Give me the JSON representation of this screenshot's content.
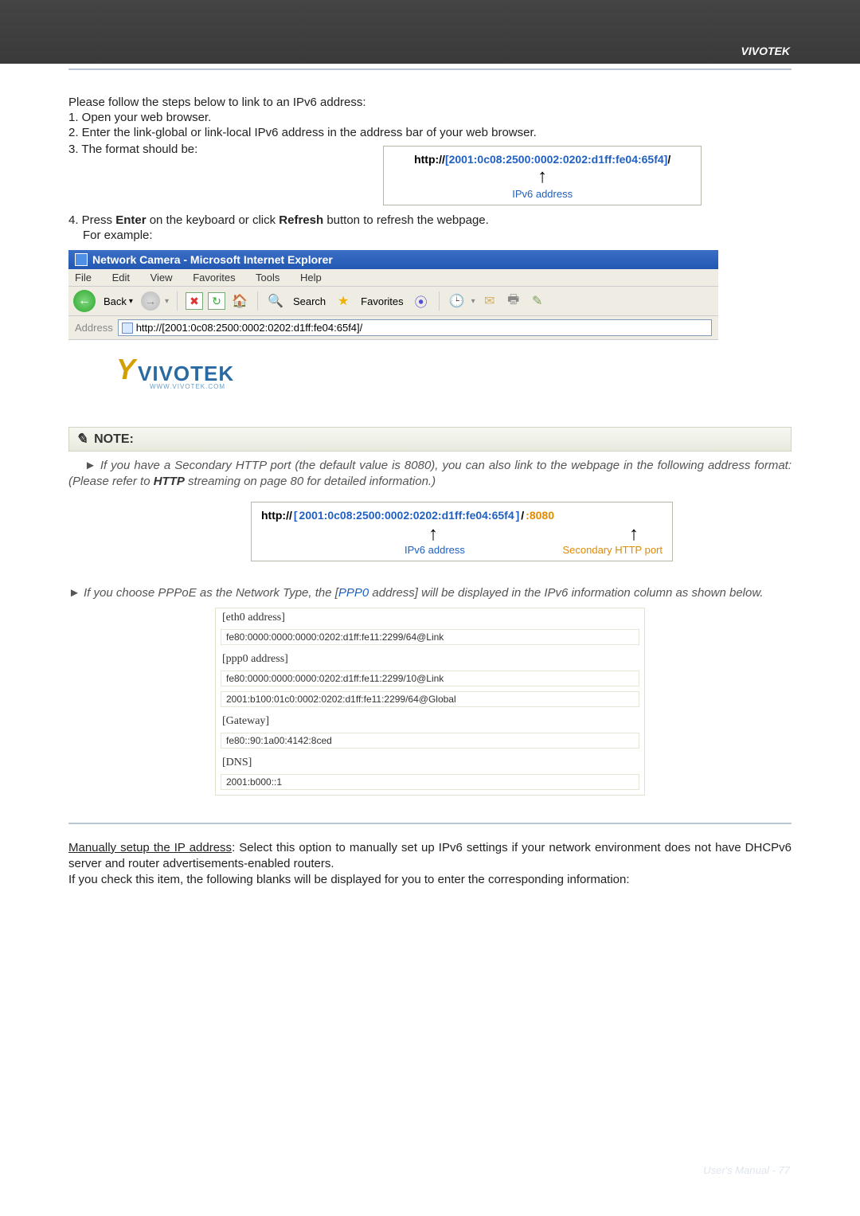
{
  "brand": "VIVOTEK",
  "intro": {
    "line": "Please follow the steps below to link to an IPv6 address:",
    "step1": "1. Open your web browser.",
    "step2": "2. Enter the link-global or link-local IPv6 address in the address bar of your web browser.",
    "step3": "3. The format should be:",
    "step4": "4. Press Enter on the keyboard or click Refresh button to refresh the webpage.",
    "step4b": "For example:",
    "enter": "Enter",
    "refresh": "Refresh"
  },
  "urlbox1": {
    "prefix": "http://",
    "open": "[",
    "addr": "2001:0c08:2500:0002:0202:d1ff:fe04:65f4",
    "close": "]",
    "suffix": "/",
    "label": "IPv6 address"
  },
  "ie": {
    "title": "Network Camera - Microsoft Internet Explorer",
    "menu": {
      "file": "File",
      "edit": "Edit",
      "view": "View",
      "fav": "Favorites",
      "tools": "Tools",
      "help": "Help"
    },
    "tb": {
      "back": "Back",
      "search": "Search",
      "fav": "Favorites"
    },
    "addrlabel": "Address",
    "addrvalue": "http://[2001:0c08:2500:0002:0202:d1ff:fe04:65f4]/",
    "logo": "VIVOTEK",
    "logosub": "WWW.VIVOTEK.COM"
  },
  "note": {
    "title": "NOTE:",
    "p1a": "► If you have a Secondary HTTP port (the default value is 8080), you can also link to the webpage in the following address format: (Please refer to ",
    "p1b": "HTTP",
    "p1c": " streaming on page 80 for detailed information.)",
    "p2a": "► If you choose PPPoE as the Network Type, the [",
    "p2b": "PPP0",
    "p2c": " address] will be displayed in the IPv6 information column as shown below."
  },
  "urlbox2": {
    "prefix": "http://",
    "open": "[",
    "addr": "2001:0c08:2500:0002:0202:d1ff:fe04:65f4",
    "close": "]",
    "suffix": "/",
    "port": ":8080",
    "label1": "IPv6 address",
    "label2": "Secondary HTTP port"
  },
  "ipv6table": {
    "eth_hdr": "[eth0 address]",
    "eth_val": "fe80:0000:0000:0000:0202:d1ff:fe11:2299/64@Link",
    "ppp_hdr": "[ppp0 address]",
    "ppp_val1": "fe80:0000:0000:0000:0202:d1ff:fe11:2299/10@Link",
    "ppp_val2": "2001:b100:01c0:0002:0202:d1ff:fe11:2299/64@Global",
    "gw_hdr": "[Gateway]",
    "gw_val": "fe80::90:1a00:4142:8ced",
    "dns_hdr": "[DNS]",
    "dns_val": "2001:b000::1"
  },
  "manual": {
    "lead": "Manually setup the IP address",
    "rest1": ": Select this option to manually set up IPv6 settings if your network environment does not have DHCPv6 server and router advertisements-enabled routers.",
    "rest2": "If you check this item, the following blanks will be displayed for you to enter the corresponding information:"
  },
  "footer": "User's Manual - 77"
}
